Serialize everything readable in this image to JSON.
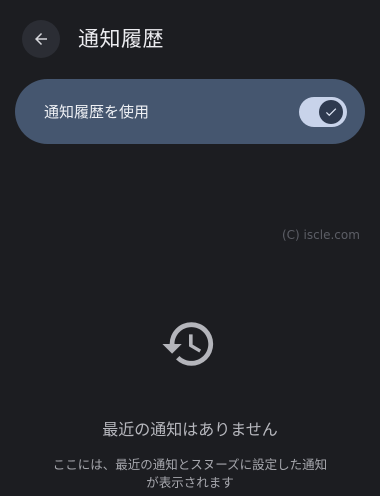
{
  "header": {
    "title": "通知履歴",
    "back_icon": "arrow-left-icon"
  },
  "setting": {
    "label": "通知履歴を使用",
    "toggle_on": true,
    "check_icon": "check-icon"
  },
  "watermark": "(C) iscle.com",
  "empty_state": {
    "icon": "history-icon",
    "title": "最近の通知はありません",
    "description_line1": "ここには、最近の通知とスヌーズに設定した通知",
    "description_line2": "が表示されます"
  },
  "colors": {
    "background": "#1c1d21",
    "card": "#45566f",
    "toggle_track": "#c8d3ea",
    "toggle_thumb": "#2e3a4f"
  }
}
